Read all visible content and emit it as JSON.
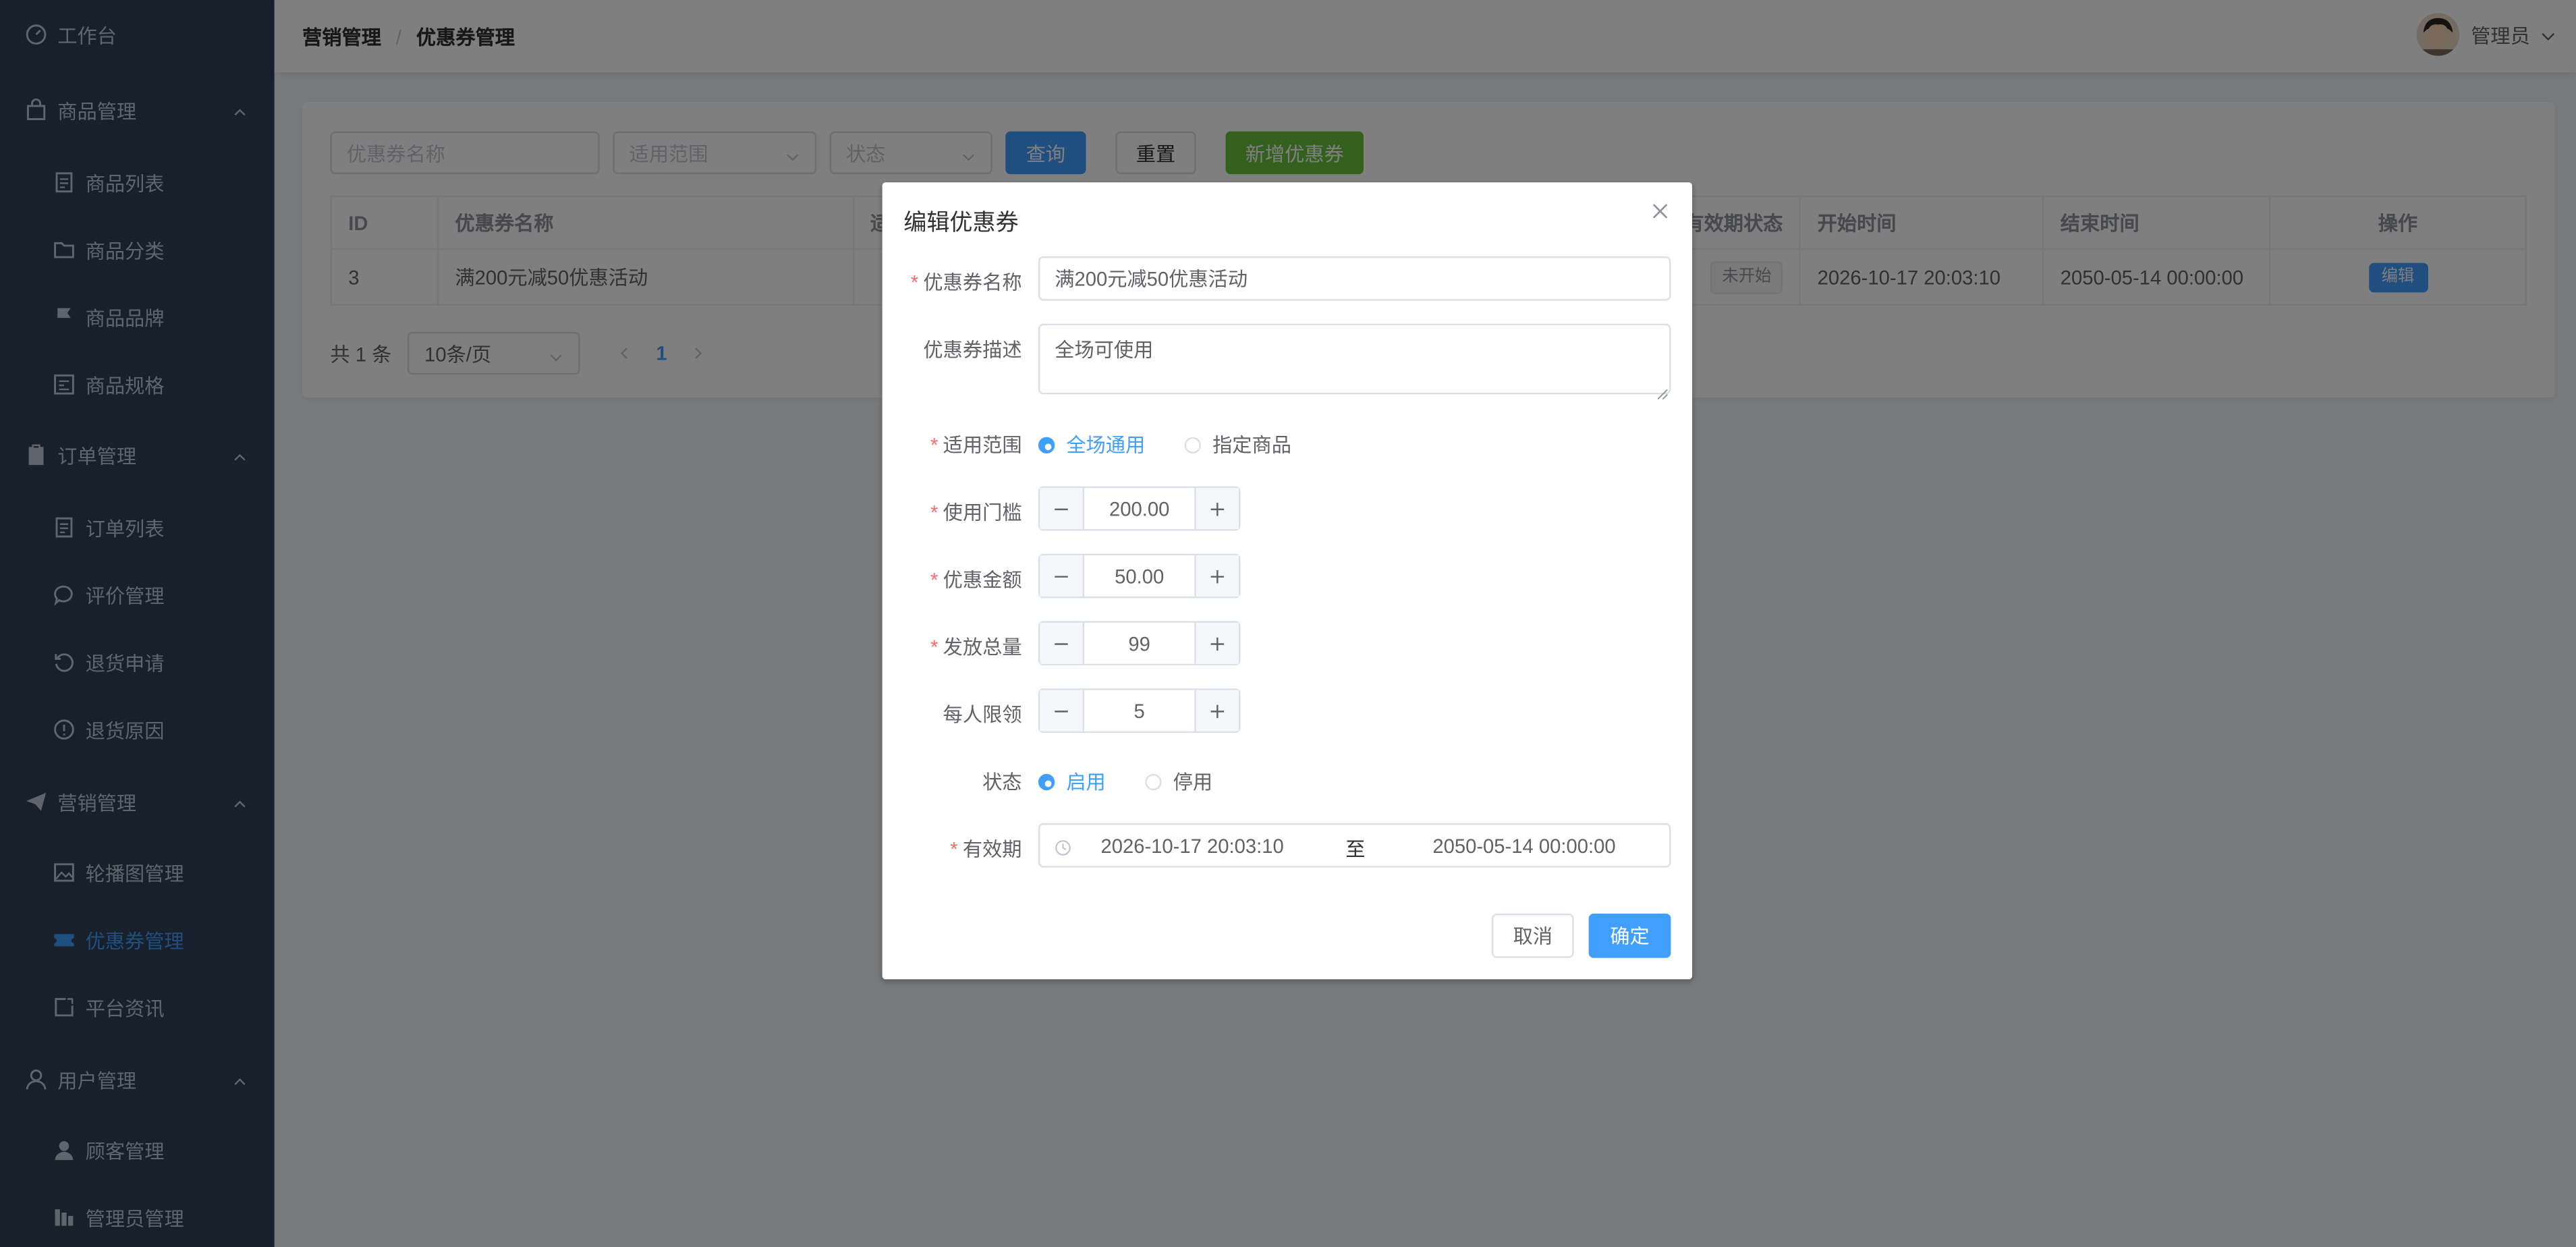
{
  "sidebar": {
    "workbench": "工作台",
    "groups": [
      {
        "label": "商品管理",
        "items": [
          "商品列表",
          "商品分类",
          "商品品牌",
          "商品规格"
        ]
      },
      {
        "label": "订单管理",
        "items": [
          "订单列表",
          "评价管理",
          "退货申请",
          "退货原因"
        ]
      },
      {
        "label": "营销管理",
        "items": [
          "轮播图管理",
          "优惠券管理",
          "平台资讯"
        ]
      },
      {
        "label": "用户管理",
        "items": [
          "顾客管理",
          "管理员管理"
        ]
      }
    ],
    "active_item": "优惠券管理"
  },
  "header": {
    "breadcrumb": [
      "营销管理",
      "优惠券管理"
    ],
    "breadcrumb_sep": "/",
    "user_name": "管理员"
  },
  "search": {
    "name_placeholder": "优惠券名称",
    "scope_placeholder": "适用范围",
    "status_placeholder": "状态",
    "query_label": "查询",
    "reset_label": "重置",
    "add_label": "新增优惠券"
  },
  "table": {
    "columns": [
      "ID",
      "优惠券名称",
      "适",
      "有效期状态",
      "开始时间",
      "结束时间",
      "操作"
    ],
    "rows": [
      {
        "id": "3",
        "name": "满200元减50优惠活动",
        "state": "未开始",
        "start": "2026-10-17 20:03:10",
        "end": "2050-05-14 00:00:00",
        "action": "编辑"
      }
    ]
  },
  "pagination": {
    "total": "共 1 条",
    "page_size": "10条/页",
    "current": "1"
  },
  "dialog": {
    "title": "编辑优惠券",
    "fields": {
      "name": {
        "label": "优惠券名称",
        "value": "满200元减50优惠活动"
      },
      "desc": {
        "label": "优惠券描述",
        "value": "全场可使用"
      },
      "scope": {
        "label": "适用范围",
        "options": [
          "全场通用",
          "指定商品"
        ],
        "selected": "全场通用"
      },
      "threshold": {
        "label": "使用门槛",
        "value": "200.00"
      },
      "amount": {
        "label": "优惠金额",
        "value": "50.00"
      },
      "total": {
        "label": "发放总量",
        "value": "99"
      },
      "limit": {
        "label": "每人限领",
        "value": "5"
      },
      "status": {
        "label": "状态",
        "options": [
          "启用",
          "停用"
        ],
        "selected": "启用"
      },
      "period": {
        "label": "有效期",
        "start": "2026-10-17 20:03:10",
        "separator": "至",
        "end": "2050-05-14 00:00:00"
      }
    },
    "required_mark": "*",
    "cancel_label": "取消",
    "confirm_label": "确定"
  },
  "colors": {
    "primary": "#409eff",
    "success": "#67c23a",
    "sidebar_bg": "#304156",
    "required": "#f56c6c"
  }
}
